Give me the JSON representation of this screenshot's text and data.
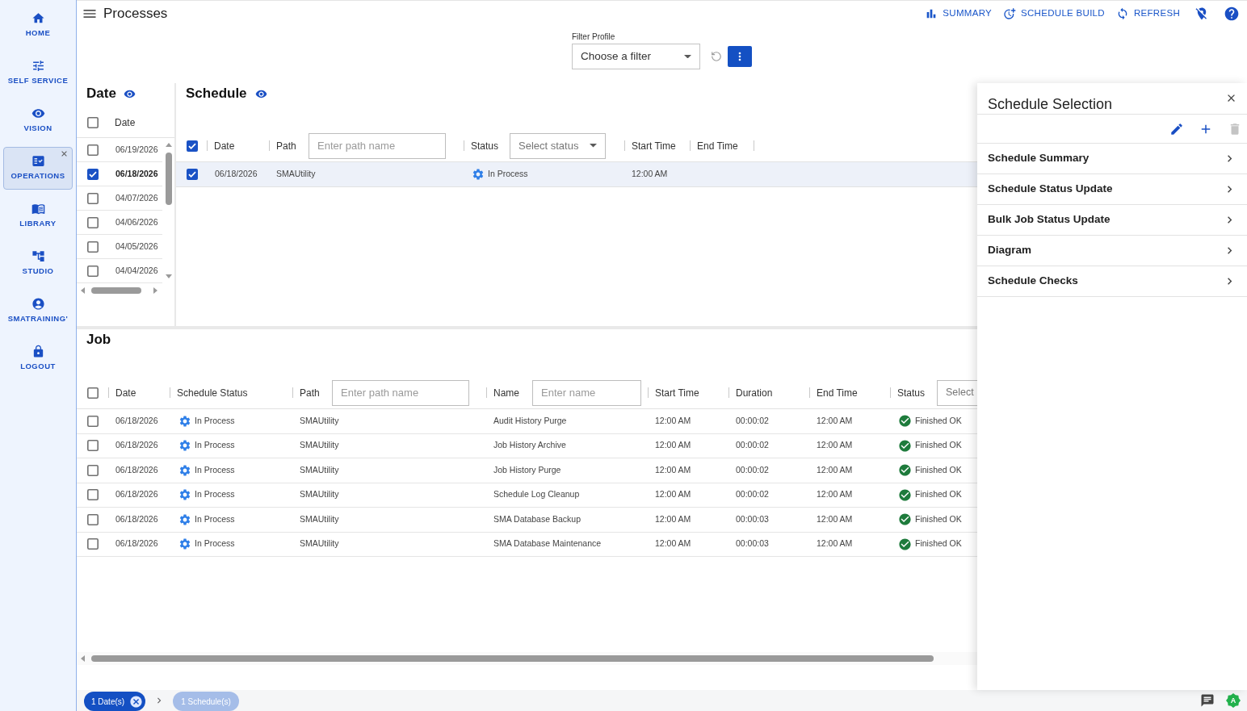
{
  "sidebar": {
    "items": [
      {
        "label": "HOME",
        "selected": false
      },
      {
        "label": "SELF SERVICE",
        "selected": false
      },
      {
        "label": "VISION",
        "selected": false
      },
      {
        "label": "OPERATIONS",
        "selected": true
      },
      {
        "label": "LIBRARY",
        "selected": false
      },
      {
        "label": "STUDIO",
        "selected": false
      },
      {
        "label": "SMATRAINING'",
        "selected": false
      },
      {
        "label": "LOGOUT",
        "selected": false
      }
    ]
  },
  "header": {
    "title": "Processes",
    "actions": [
      {
        "label": "SUMMARY"
      },
      {
        "label": "SCHEDULE BUILD"
      },
      {
        "label": "REFRESH"
      }
    ]
  },
  "filter_profile": {
    "label": "Filter Profile",
    "placeholder": "Choose a filter"
  },
  "date_panel": {
    "title": "Date",
    "all_checked": false,
    "column": "Date",
    "rows": [
      {
        "date": "06/19/2026",
        "checked": false
      },
      {
        "date": "06/18/2026",
        "checked": true
      },
      {
        "date": "04/07/2026",
        "checked": false
      },
      {
        "date": "04/06/2026",
        "checked": false
      },
      {
        "date": "04/05/2026",
        "checked": false
      },
      {
        "date": "04/04/2026",
        "checked": false
      }
    ]
  },
  "schedule_panel": {
    "title": "Schedule",
    "all_checked": true,
    "columns": {
      "date": "Date",
      "path": "Path",
      "path_filter_placeholder": "Enter path name",
      "status": "Status",
      "status_filter_placeholder": "Select status",
      "start_time": "Start Time",
      "end_time": "End Time"
    },
    "rows": [
      {
        "checked": true,
        "date": "06/18/2026",
        "path": "SMAUtility",
        "status": "In Process",
        "start_time": "12:00 AM"
      }
    ]
  },
  "job_panel": {
    "title": "Job",
    "all_checked": false,
    "columns": {
      "date": "Date",
      "schedule_status": "Schedule Status",
      "path": "Path",
      "path_filter_placeholder": "Enter path name",
      "name": "Name",
      "name_filter_placeholder": "Enter name",
      "start_time": "Start Time",
      "duration": "Duration",
      "end_time": "End Time",
      "status": "Status",
      "status_filter_placeholder": "Select"
    },
    "rows": [
      {
        "checked": false,
        "date": "06/18/2026",
        "schedule_status": "In Process",
        "path": "SMAUtility",
        "name": "Audit History Purge",
        "start_time": "12:00 AM",
        "duration": "00:00:02",
        "end_time": "12:00 AM",
        "status": "Finished OK"
      },
      {
        "checked": false,
        "date": "06/18/2026",
        "schedule_status": "In Process",
        "path": "SMAUtility",
        "name": "Job History Archive",
        "start_time": "12:00 AM",
        "duration": "00:00:02",
        "end_time": "12:00 AM",
        "status": "Finished OK"
      },
      {
        "checked": false,
        "date": "06/18/2026",
        "schedule_status": "In Process",
        "path": "SMAUtility",
        "name": "Job History Purge",
        "start_time": "12:00 AM",
        "duration": "00:00:02",
        "end_time": "12:00 AM",
        "status": "Finished OK"
      },
      {
        "checked": false,
        "date": "06/18/2026",
        "schedule_status": "In Process",
        "path": "SMAUtility",
        "name": "Schedule Log Cleanup",
        "start_time": "12:00 AM",
        "duration": "00:00:02",
        "end_time": "12:00 AM",
        "status": "Finished OK"
      },
      {
        "checked": false,
        "date": "06/18/2026",
        "schedule_status": "In Process",
        "path": "SMAUtility",
        "name": "SMA Database Backup",
        "start_time": "12:00 AM",
        "duration": "00:00:03",
        "end_time": "12:00 AM",
        "status": "Finished OK"
      },
      {
        "checked": false,
        "date": "06/18/2026",
        "schedule_status": "In Process",
        "path": "SMAUtility",
        "name": "SMA Database Maintenance",
        "start_time": "12:00 AM",
        "duration": "00:00:03",
        "end_time": "12:00 AM",
        "status": "Finished OK"
      }
    ]
  },
  "schedule_selection": {
    "title": "Schedule Selection",
    "tools": [
      {
        "disabled": false
      },
      {
        "disabled": false
      },
      {
        "disabled": true
      }
    ],
    "items": [
      {
        "label": "Schedule Summary"
      },
      {
        "label": "Schedule Status Update"
      },
      {
        "label": "Bulk Job Status Update"
      },
      {
        "label": "Diagram"
      },
      {
        "label": "Schedule Checks"
      }
    ]
  },
  "bottom_bar": {
    "chips": [
      {
        "label": "1 Date(s)",
        "active": true
      },
      {
        "label": "1 Schedule(s)",
        "active": false
      }
    ],
    "badge": "A"
  }
}
